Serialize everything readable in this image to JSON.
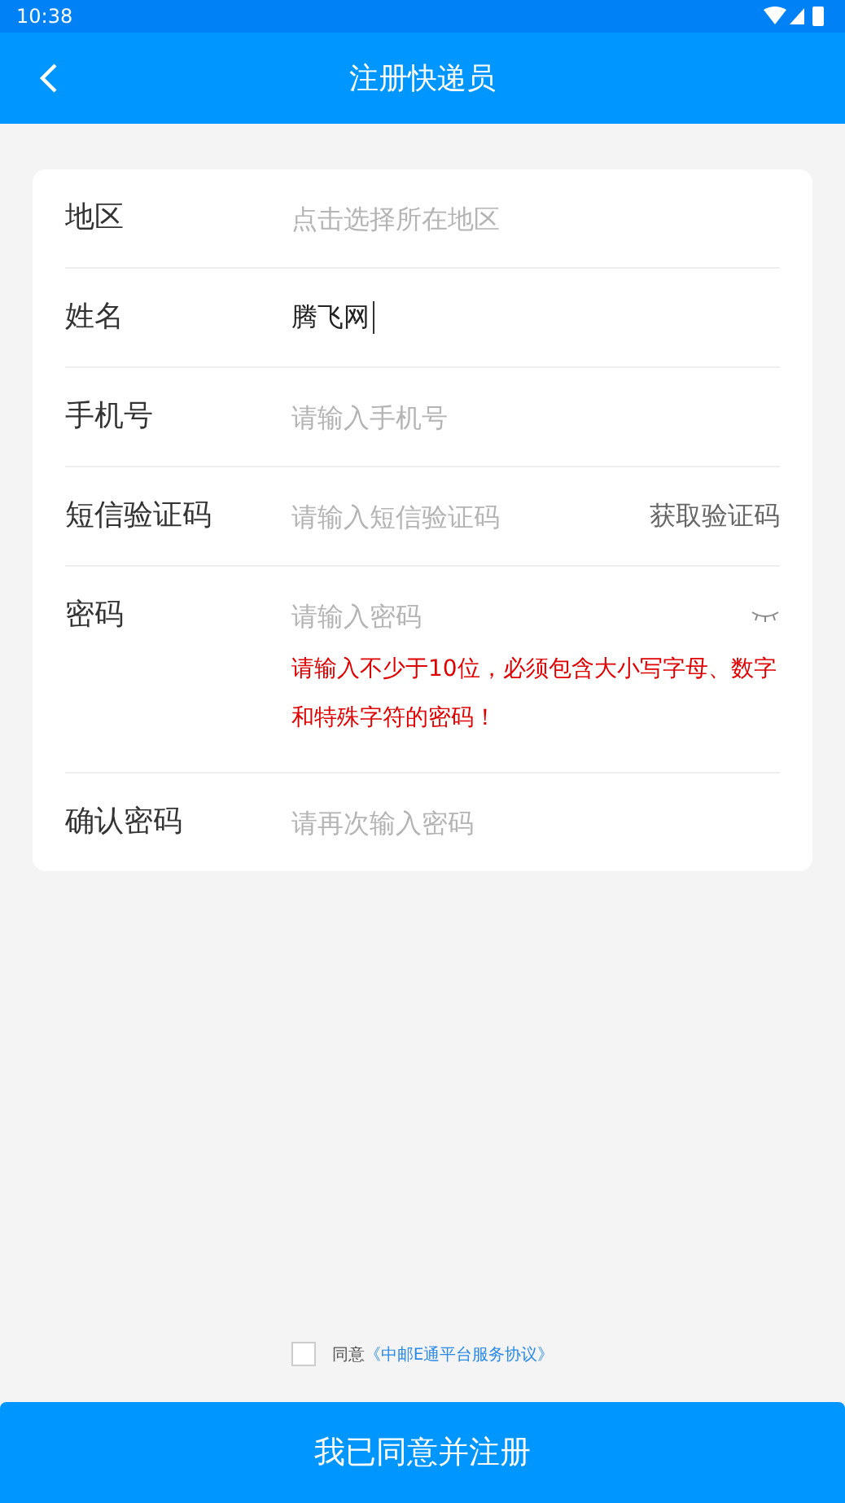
{
  "status_bar": {
    "time": "10:38"
  },
  "header": {
    "title": "注册快递员"
  },
  "fields": [
    {
      "kind": "select",
      "label": "地区",
      "placeholder": "点击选择所在地区"
    },
    {
      "kind": "text",
      "label": "姓名",
      "value": "腾飞网",
      "focused": true
    },
    {
      "kind": "text",
      "label": "手机号",
      "placeholder": "请输入手机号"
    },
    {
      "kind": "code",
      "label": "短信验证码",
      "placeholder": "请输入短信验证码",
      "action": "获取验证码"
    },
    {
      "kind": "password",
      "label": "密码",
      "placeholder": "请输入密码",
      "hint": "请输入不少于10位，必须包含大小写字母、数字和特殊字符的密码！"
    },
    {
      "kind": "text",
      "label": "确认密码",
      "placeholder": "请再次输入密码"
    }
  ],
  "agreement": {
    "checked": false,
    "text": "同意",
    "link": "《中邮E通平台服务协议》"
  },
  "submit_button": "我已同意并注册"
}
